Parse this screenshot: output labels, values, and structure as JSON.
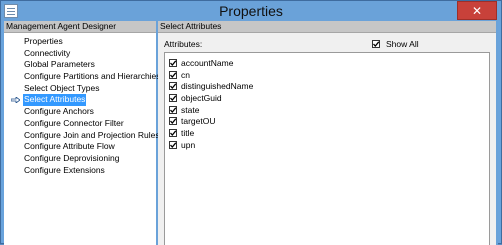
{
  "window": {
    "title": "Properties",
    "close_glyph": "✕"
  },
  "left_pane": {
    "header": "Management Agent Designer",
    "items": [
      {
        "label": "Properties"
      },
      {
        "label": "Connectivity"
      },
      {
        "label": "Global Parameters"
      },
      {
        "label": "Configure Partitions and Hierarchies"
      },
      {
        "label": "Select Object Types"
      },
      {
        "label": "Select Attributes",
        "selected": true
      },
      {
        "label": "Configure Anchors"
      },
      {
        "label": "Configure Connector Filter"
      },
      {
        "label": "Configure Join and Projection Rules"
      },
      {
        "label": "Configure Attribute Flow"
      },
      {
        "label": "Configure Deprovisioning"
      },
      {
        "label": "Configure Extensions"
      }
    ]
  },
  "right_pane": {
    "header": "Select Attributes",
    "attributes_label": "Attributes:",
    "show_all_label": "Show All",
    "show_all_checked": true,
    "attributes": [
      {
        "name": "accountName",
        "checked": true
      },
      {
        "name": "cn",
        "checked": true
      },
      {
        "name": "distinguishedName",
        "checked": true
      },
      {
        "name": "objectGuid",
        "checked": true
      },
      {
        "name": "state",
        "checked": true
      },
      {
        "name": "targetOU",
        "checked": true
      },
      {
        "name": "title",
        "checked": true
      },
      {
        "name": "upn",
        "checked": true
      }
    ]
  },
  "colors": {
    "selection": "#3399ff",
    "titlebar": "#6aa2d9",
    "close": "#c8413a"
  },
  "icons": {
    "app": "properties-window-icon",
    "selected_marker": "arrow-right-icon",
    "check": "checkmark-icon"
  }
}
